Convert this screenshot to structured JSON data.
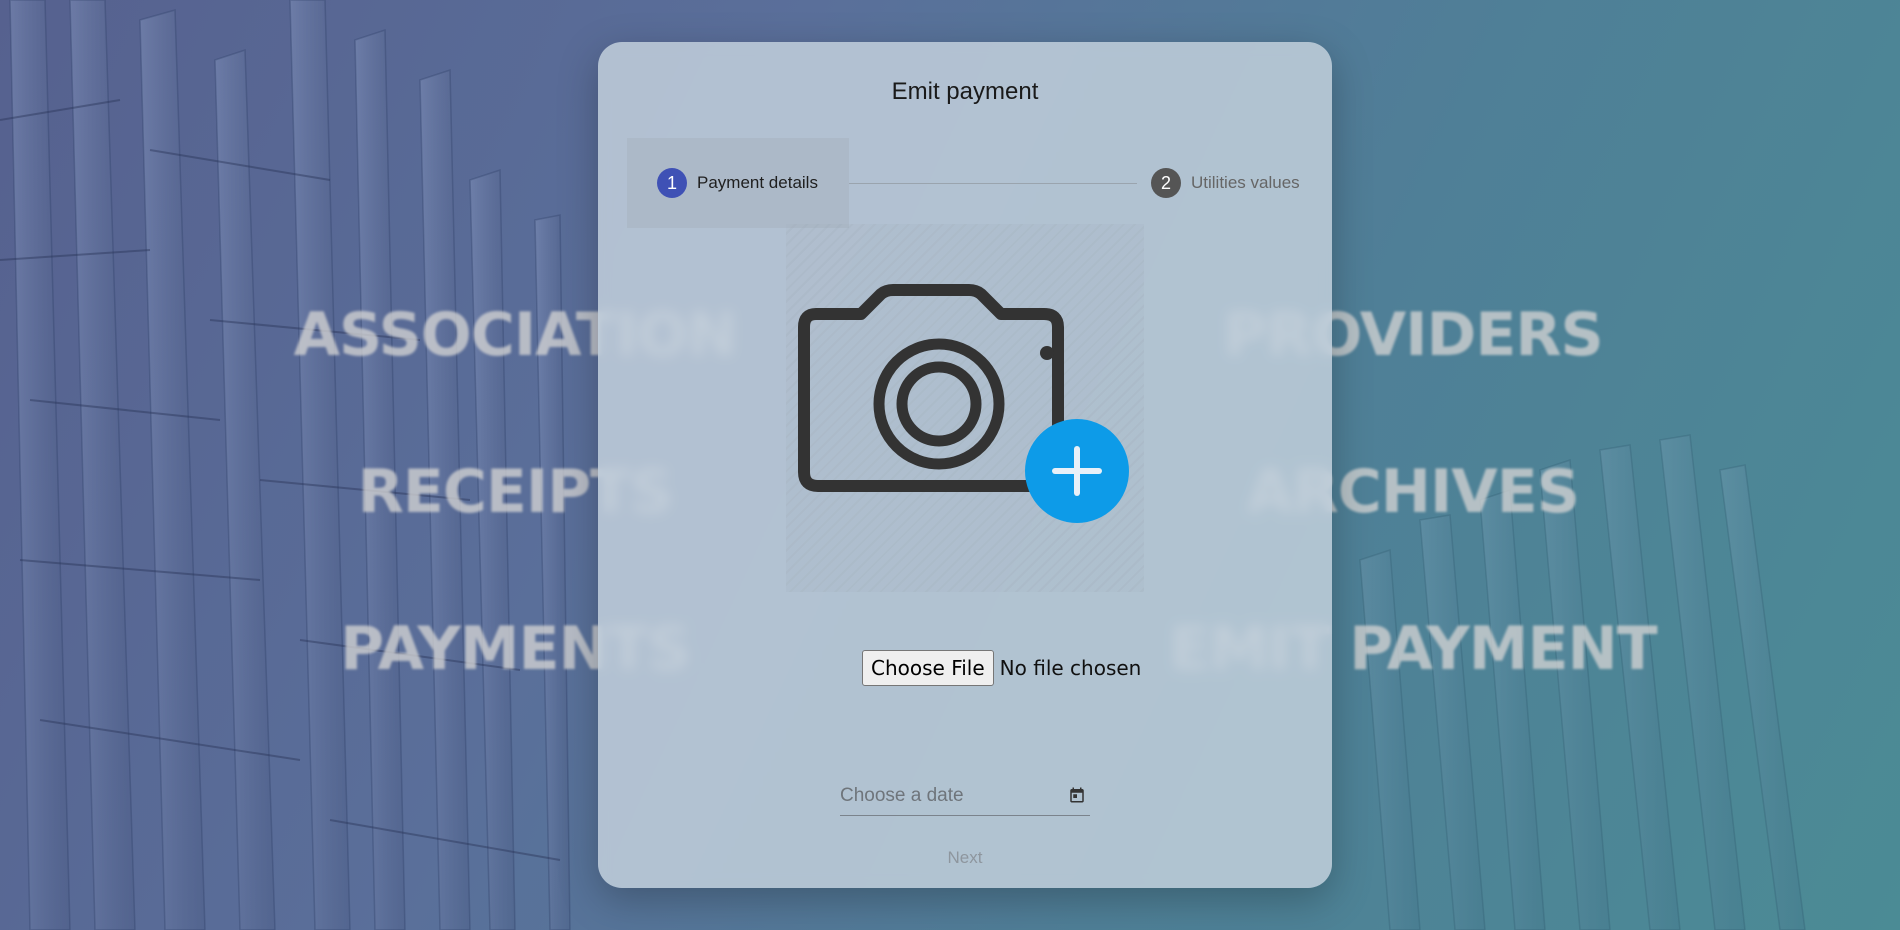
{
  "background": {
    "menu_left": [
      "ASSOCIATION",
      "RECEIPTS",
      "PAYMENTS"
    ],
    "menu_right": [
      "PROVIDERS",
      "ARCHIVES",
      "EMIT PAYMENT"
    ]
  },
  "dialog": {
    "title": "Emit payment",
    "steps": [
      {
        "number": "1",
        "label": "Payment details",
        "active": true
      },
      {
        "number": "2",
        "label": "Utilities values",
        "active": false
      }
    ],
    "preview_icon": "camera-add-icon",
    "file_input": {
      "button_label": "Choose File",
      "status": "No file chosen"
    },
    "date_input": {
      "placeholder": "Choose a date",
      "icon": "calendar-icon"
    },
    "next_label": "Next"
  },
  "colors": {
    "step_active": "#3f51b5",
    "step_inactive": "#555555",
    "add_badge": "#0d9be8",
    "camera_stroke": "#333333"
  }
}
